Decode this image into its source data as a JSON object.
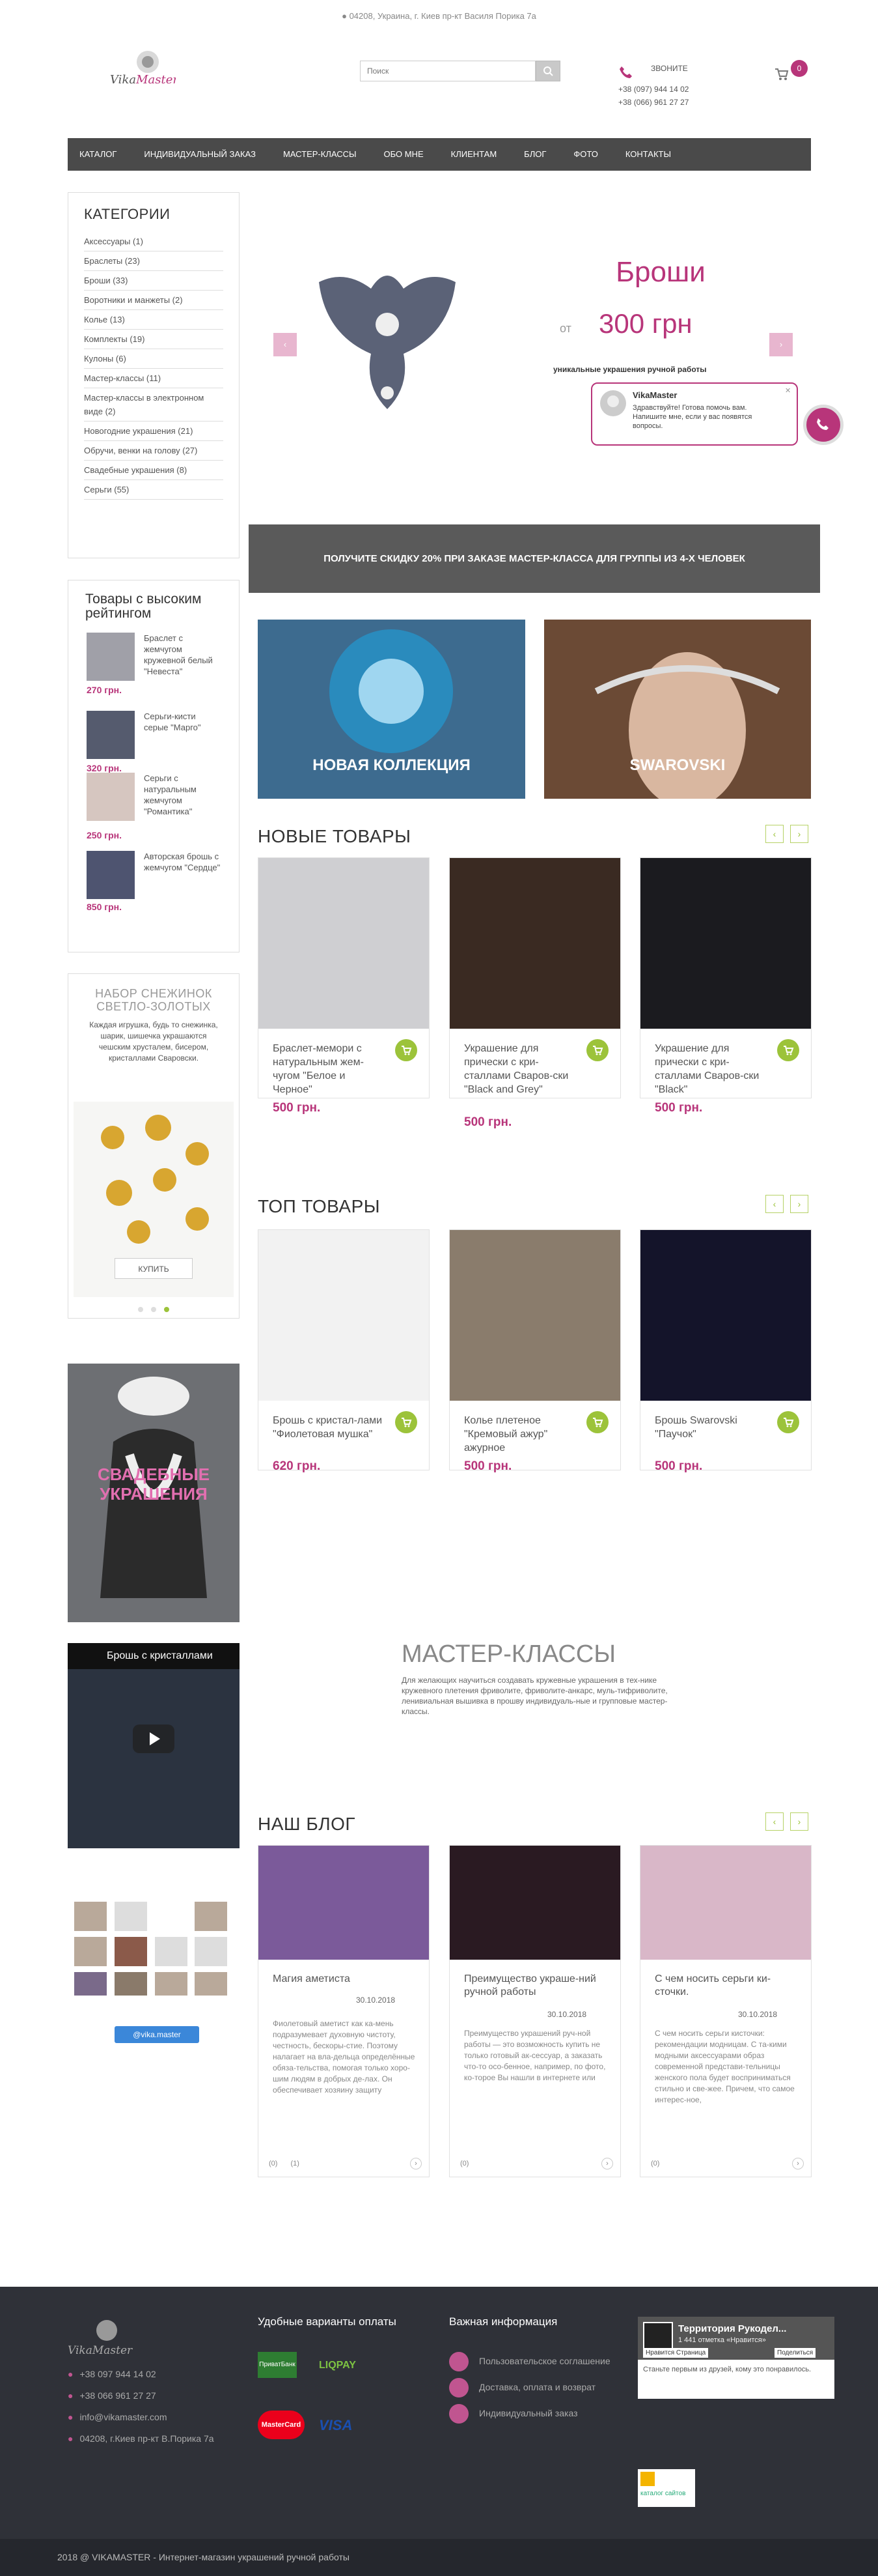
{
  "colors": {
    "accent": "#b8357a",
    "green": "#9cc33a",
    "nav": "#4a4a4a",
    "footer": "#2f3138"
  },
  "topbar": {
    "address": "04208, Украина, г. Киев пр-кт Василя Порика 7а"
  },
  "header": {
    "logo_text": "VikaMaster",
    "search_placeholder": "Поиск",
    "call_label": "ЗВОНИТЕ",
    "phone1": "+38 (097) 944 14 02",
    "phone2": "+38 (066) 961 27 27",
    "cart_count": "0"
  },
  "nav": {
    "items": [
      "КАТАЛОГ",
      "ИНДИВИДУАЛЬНЫЙ ЗАКАЗ",
      "МАСТЕР-КЛАССЫ",
      "ОБО МНЕ",
      "КЛИЕНТАМ",
      "БЛОГ",
      "ФОТО",
      "КОНТАКТЫ"
    ]
  },
  "categories": {
    "title": "КАТЕГОРИИ",
    "items": [
      "Аксессуары (1)",
      "Браслеты (23)",
      "Броши (33)",
      "Воротники и манжеты (2)",
      "Колье (13)",
      "Комплекты (19)",
      "Кулоны (6)",
      "Мастер-классы (11)",
      "Мастер-классы в электронном виде (2)",
      "Новогодние украшения (21)",
      "Обручи, венки на голову (27)",
      "Свадебные украшения (8)",
      "Серьги (55)"
    ]
  },
  "rated": {
    "title": "Товары с высоким рейтингом",
    "items": [
      {
        "name": "Браслет с жемчугом кружевной белый \"Невеста\"",
        "price": "270 грн."
      },
      {
        "name": "Серьги-кисти серые \"Марго\"",
        "price": "320 грн."
      },
      {
        "name": "Серьги с натуральным жемчугом \"Романтика\"",
        "price": "250 грн."
      },
      {
        "name": "Авторская брошь с жемчугом \"Сердце\"",
        "price": "850 грн."
      }
    ]
  },
  "snow": {
    "title": "НАБОР СНЕЖИНОК СВЕТЛО-ЗОЛОТЫХ",
    "text": "Каждая игрушка, будь то снежинка, шарик, шишечка украшаются чешским хрусталем, бисером, кристаллами Сваровски.",
    "button": "КУПИТЬ"
  },
  "wedding": {
    "text": "СВАДЕБНЫЕ УКРАШЕНИЯ"
  },
  "video": {
    "title": "Брошь с кристаллами"
  },
  "insta": {
    "button": "@vika.master"
  },
  "slider": {
    "title": "Броши",
    "from": "от",
    "price": "300 грн",
    "subtitle": "уникальные украшения ручной работы"
  },
  "chat": {
    "name": "VikaMaster",
    "message": "Здравствуйте! Готова помочь вам. Напишите мне, если у вас появятся вопросы."
  },
  "promo": {
    "text": "ПОЛУЧИТЕ скидку 20% при заказе мастер-класса для группы из 4-х человек"
  },
  "banners": {
    "left": "НОВАЯ КОЛЛЕКЦИЯ",
    "right": "SWAROVSKI"
  },
  "new_products": {
    "title": "НОВЫЕ ТОВАРЫ",
    "items": [
      {
        "name": "Браслет-мемори с натуральным жем-чугом \"Белое и Черное\"",
        "price": "500 грн."
      },
      {
        "name": "Украшение для прически с кри-сталлами Сваров-ски \"Black and Grey\"",
        "price": "500 грн."
      },
      {
        "name": "Украшение для прически с кри-сталлами Сваров-ски \"Black\"",
        "price": "500 грн."
      }
    ]
  },
  "top_products": {
    "title": "ТОП ТОВАРЫ",
    "items": [
      {
        "name": "Брошь с кристал-лами \"Фиолетовая мушка\"",
        "price": "620 грн."
      },
      {
        "name": "Колье плетеное \"Кремовый ажур\" ажурное",
        "price": "500 грн."
      },
      {
        "name": "Брошь Swarovski \"Паучок\"",
        "price": "500 грн."
      }
    ]
  },
  "master": {
    "title": "МАСТЕР-КЛАССЫ",
    "text": "Для желающих научиться создавать кружевные украшения в тех-нике кружевного плетения фриволите, фриволите-анкарс, муль-тифриволите, ленивиальная вышивка в прошву индивидуаль-ные и групповые мастер-классы."
  },
  "blog": {
    "title": "НАШ БЛОГ",
    "posts": [
      {
        "title": "Магия аметиста",
        "date": "30.10.2018",
        "text": "Фиолетовый аметист как ка-мень подразумевает духовную чистоту, честность, бескоры-стие. Поэтому налагает на вла-дельца определённые обяза-тельства, помогая только хоро-шим людям в добрых де-лах. Он обеспечивает хозяину защиту",
        "c1": "(0)",
        "c2": "(1)"
      },
      {
        "title": "Преимущество украше-ний ручной работы",
        "date": "30.10.2018",
        "text": "Преимущество украшений руч-ной работы — это возможность купить не только готовый ак-сессуар, а заказать что-то осо-бенное, например, по фото, ко-торое Вы нашли в интернете или",
        "c1": "(0)",
        "c2": ""
      },
      {
        "title": "С чем носить серьги ки-сточки.",
        "date": "30.10.2018",
        "text": "С чем носить серьги кисточки: рекомендации модницам. С та-кими модными аксессуарами образ современной представи-тельницы женского пола будет восприниматься стильно и све-жее. Причем, что самое интерес-ное,",
        "c1": "(0)",
        "c2": ""
      }
    ]
  },
  "footer": {
    "logo_text": "VikaMaster",
    "contacts": [
      "+38 097 944 14 02",
      "+38 066 961 27 27",
      "info@vikamaster.com",
      "04208, г.Киев пр-кт В.Порика 7а"
    ],
    "pay_title": "Удобные варианты оплаты",
    "pay": [
      "ПриватБанк",
      "LIQPAY",
      "MasterCard",
      "VISA"
    ],
    "info_title": "Важная информация",
    "info": [
      "Пользовательское соглашение",
      "Доставка, оплата и возврат",
      "Индивидуальный заказ"
    ],
    "fb_page": "Территория Рукодел...",
    "fb_likes": "1 441 отметка «Нравится»",
    "fb_like_btn": "Нравится Страница",
    "fb_share": "Поделиться",
    "fb_text": "Станьте первым из друзей, кому это понравилось.",
    "catalog": "каталог сайтов",
    "copyright": "2018 @ VIKAMASTER - Интернет-магазин украшений ручной работы"
  }
}
